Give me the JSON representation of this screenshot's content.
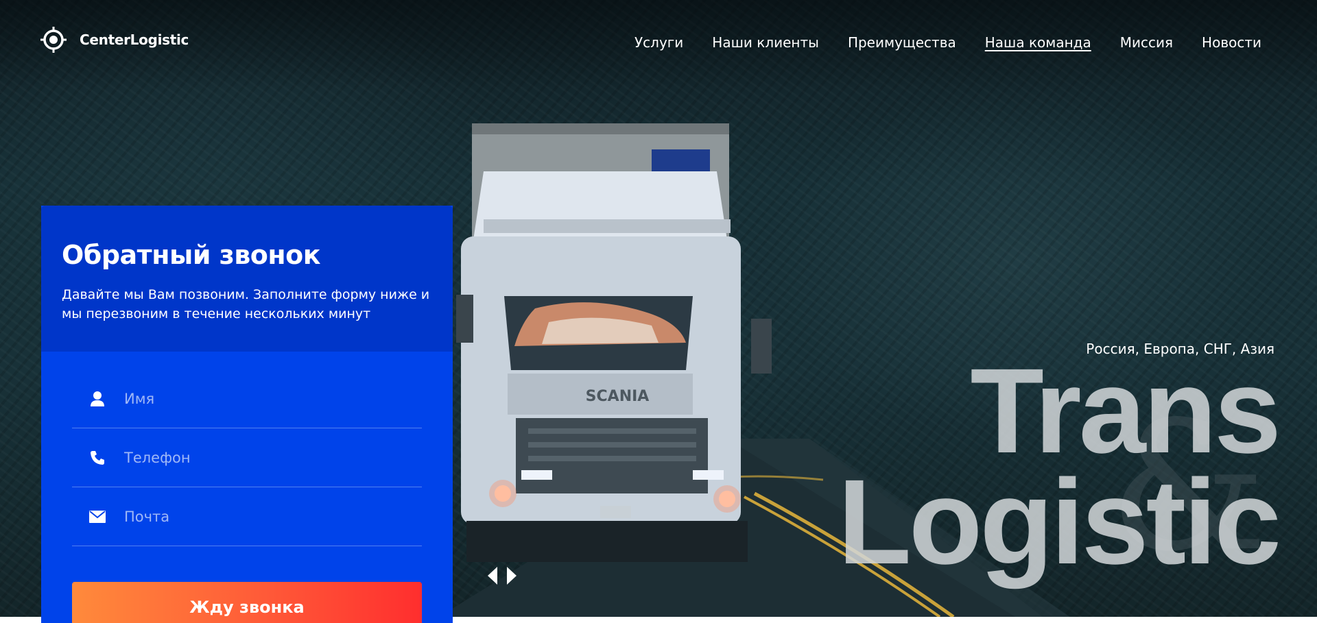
{
  "brand": {
    "name": "CenterLogistic",
    "icon": "target-icon"
  },
  "nav": {
    "items": [
      {
        "label": "Услуги",
        "active": false
      },
      {
        "label": "Наши клиенты",
        "active": false
      },
      {
        "label": "Преимущества",
        "active": false
      },
      {
        "label": "Наша команда",
        "active": true
      },
      {
        "label": "Миссия",
        "active": false
      },
      {
        "label": "Новости",
        "active": false
      }
    ]
  },
  "callback": {
    "title": "Обратный звонок",
    "subtitle": "Давайте мы Вам позвоним. Заполните форму ниже и мы перезвоним в течение нескольких минут",
    "fields": [
      {
        "placeholder": "Имя",
        "icon": "user-icon"
      },
      {
        "placeholder": "Телефон",
        "icon": "phone-icon"
      },
      {
        "placeholder": "Почта",
        "icon": "envelope-icon"
      }
    ],
    "submit_label": "Жду звонка"
  },
  "hero": {
    "regions": "Россия, Европа, СНГ, Азия",
    "headline_line1": "Trans",
    "headline_line2": "Logistic",
    "ampersand": "&",
    "truck_brand": "SCANIA"
  },
  "colors": {
    "form_blue": "#0043ea",
    "form_header_blue": "#0036c9",
    "button_gradient_start": "#ff8a3b",
    "button_gradient_end": "#ff2e2e"
  }
}
